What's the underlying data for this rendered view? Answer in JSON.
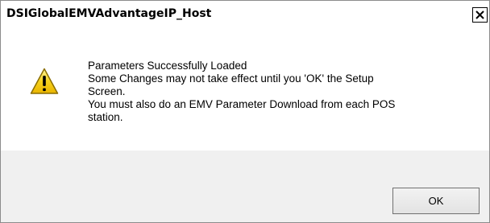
{
  "window": {
    "title": "DSIGlobalEMVAdvantageIP_Host",
    "close_glyph": "×"
  },
  "message": {
    "icon": "warning-icon",
    "lines": [
      "Parameters Successfully Loaded",
      "Some Changes may not take effect until you 'OK' the Setup",
      "Screen.",
      "You must also do an EMV Parameter Download from each POS",
      "station."
    ]
  },
  "buttons": {
    "ok_label": "OK"
  },
  "colors": {
    "footer_bg": "#f0f0f0",
    "warning_yellow": "#f7c800",
    "warning_outline": "#8a6d00"
  }
}
